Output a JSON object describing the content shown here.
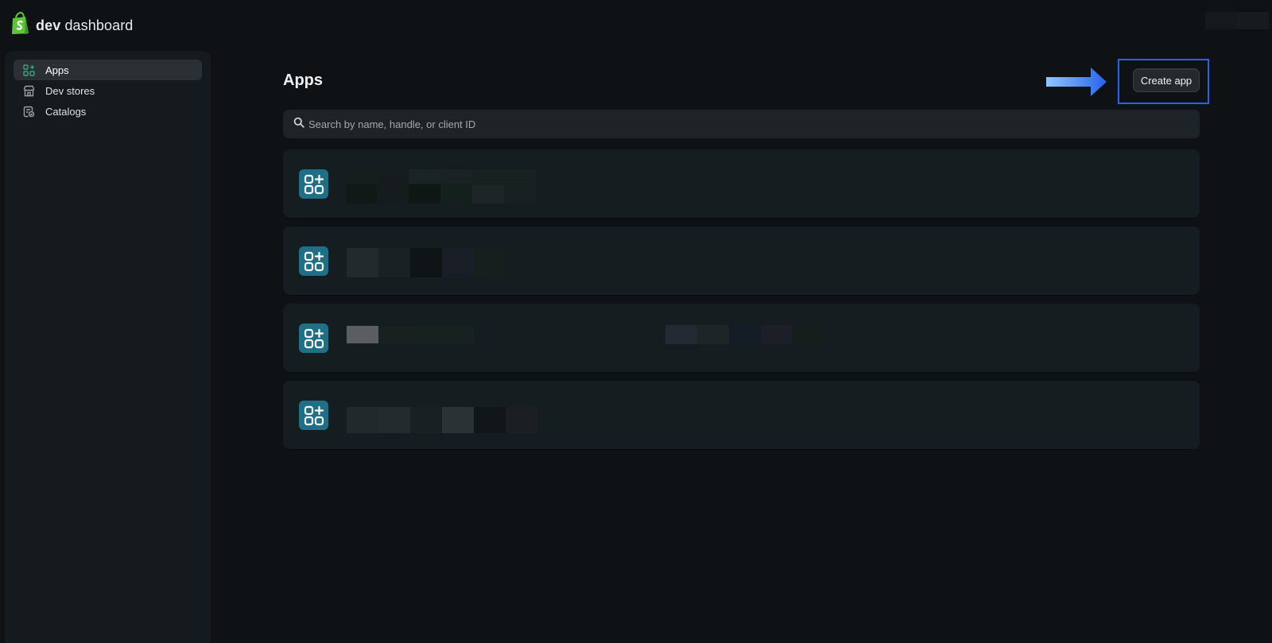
{
  "header": {
    "brand_bold": "dev",
    "brand_rest": "dashboard",
    "logo_icon": "shopify-bag-icon"
  },
  "sidebar": {
    "items": [
      {
        "label": "Apps",
        "icon": "apps-grid-icon",
        "active": true
      },
      {
        "label": "Dev stores",
        "icon": "store-icon",
        "active": false
      },
      {
        "label": "Catalogs",
        "icon": "catalog-icon",
        "active": false
      }
    ]
  },
  "main": {
    "title": "Apps",
    "create_button": "Create app",
    "search_placeholder": "Search by name, handle, or client ID",
    "app_count": 4
  },
  "colors": {
    "background": "#0e1215",
    "sidebar": "#141a1d",
    "card": "#161d20",
    "app_icon": "#1f6f87",
    "highlight": "#2563eb",
    "arrow": "#3b82f6",
    "brand_green": "#5ec43a"
  }
}
